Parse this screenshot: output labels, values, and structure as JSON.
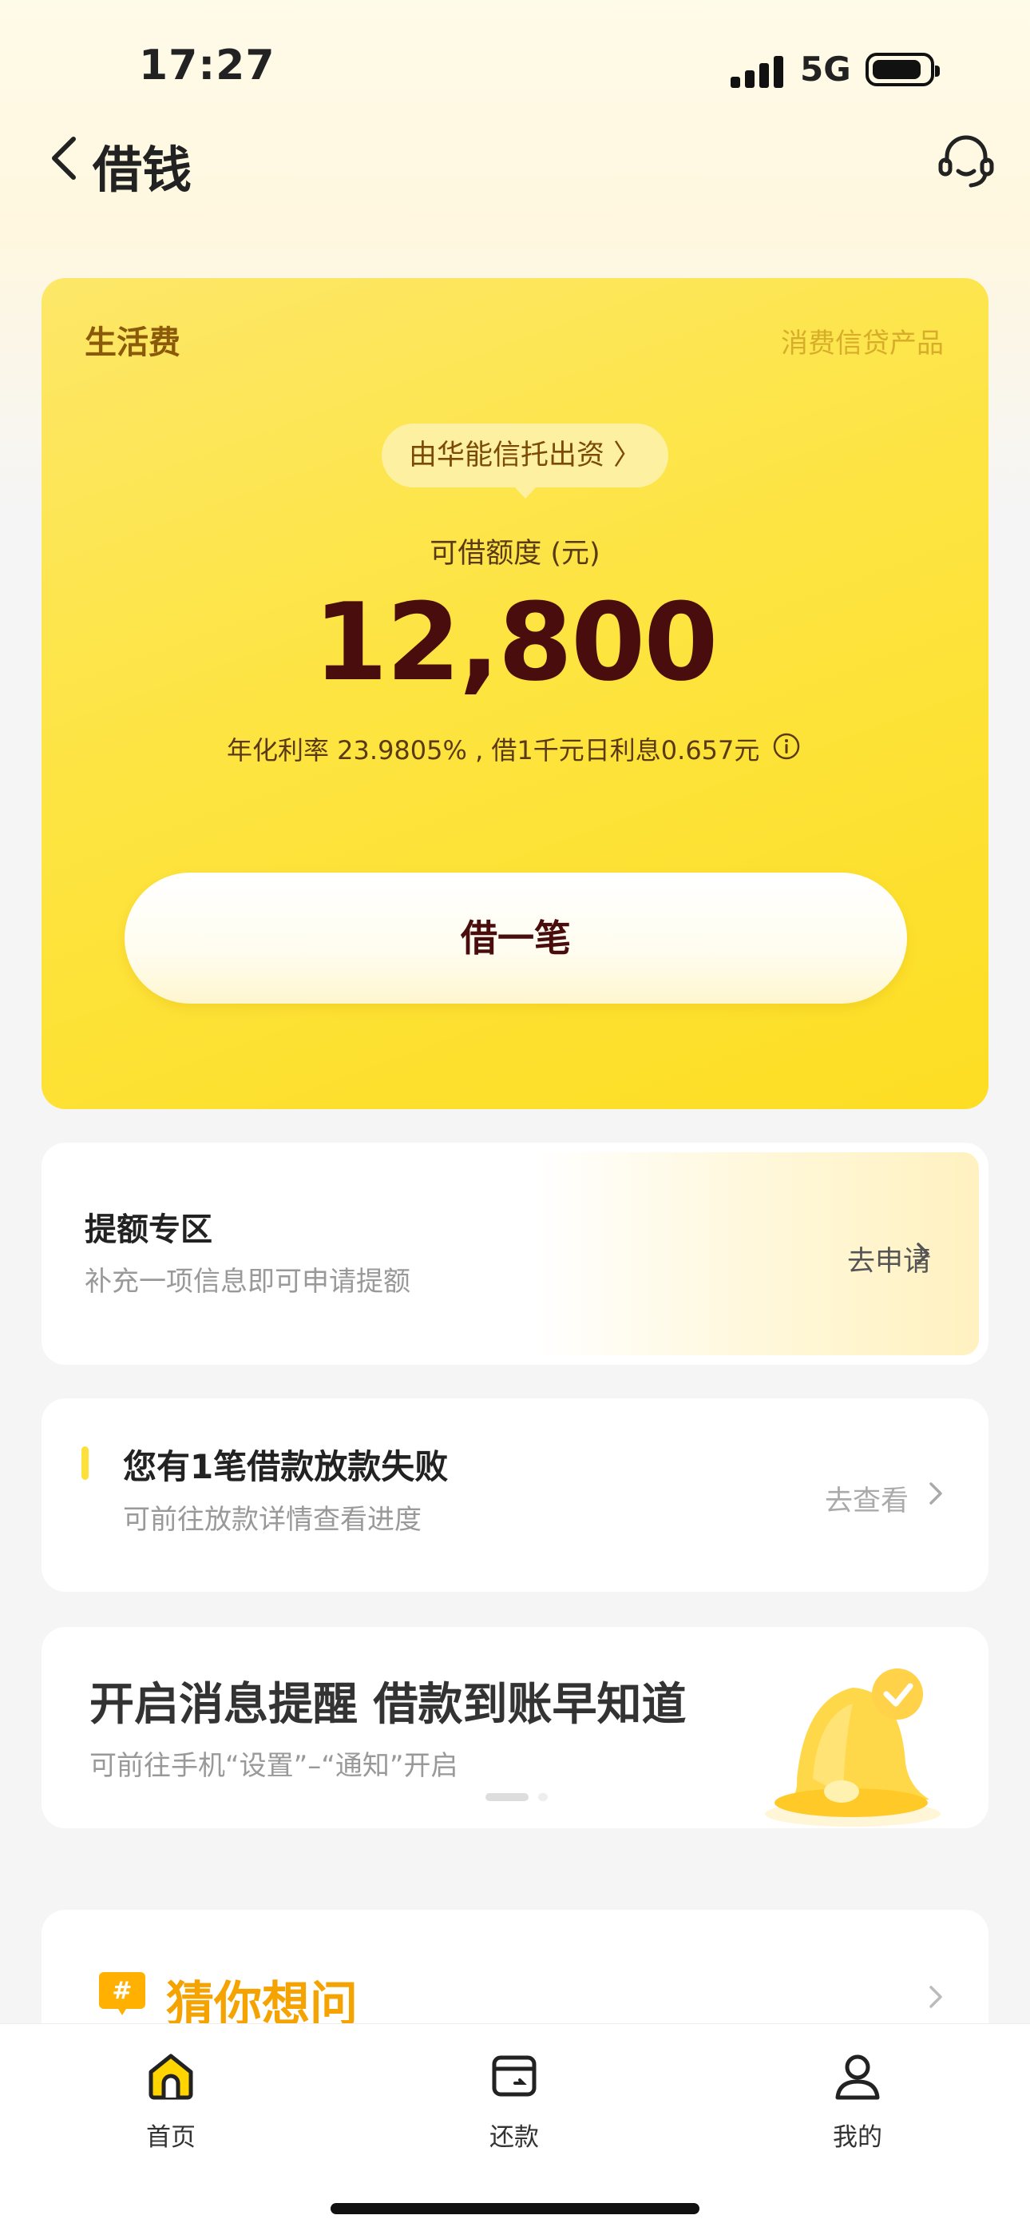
{
  "status_bar": {
    "time": "17:27",
    "network": "5G"
  },
  "nav": {
    "title": "借钱"
  },
  "loan_card": {
    "title": "生活费",
    "tag": "消费信贷产品",
    "funder": "由华能信托出资 〉",
    "limit_label": "可借额度 (元)",
    "amount": "12,800",
    "rate_text": "年化利率  23.9805% , 借1千元日利息0.657元",
    "borrow_button": "借一笔"
  },
  "boost": {
    "title": "提额专区",
    "subtitle": "补充一项信息即可申请提额",
    "link": "去申请"
  },
  "fail_notice": {
    "title": "您有1笔借款放款失败",
    "subtitle": "可前往放款详情查看进度",
    "link": "去查看"
  },
  "notify_banner": {
    "title": "开启消息提醒 借款到账早知道",
    "subtitle": "可前往手机“设置”–“通知”开启"
  },
  "faq": {
    "title": "猜你想问"
  },
  "tabbar": {
    "items": [
      {
        "label": "首页"
      },
      {
        "label": "还款"
      },
      {
        "label": "我的"
      }
    ]
  }
}
